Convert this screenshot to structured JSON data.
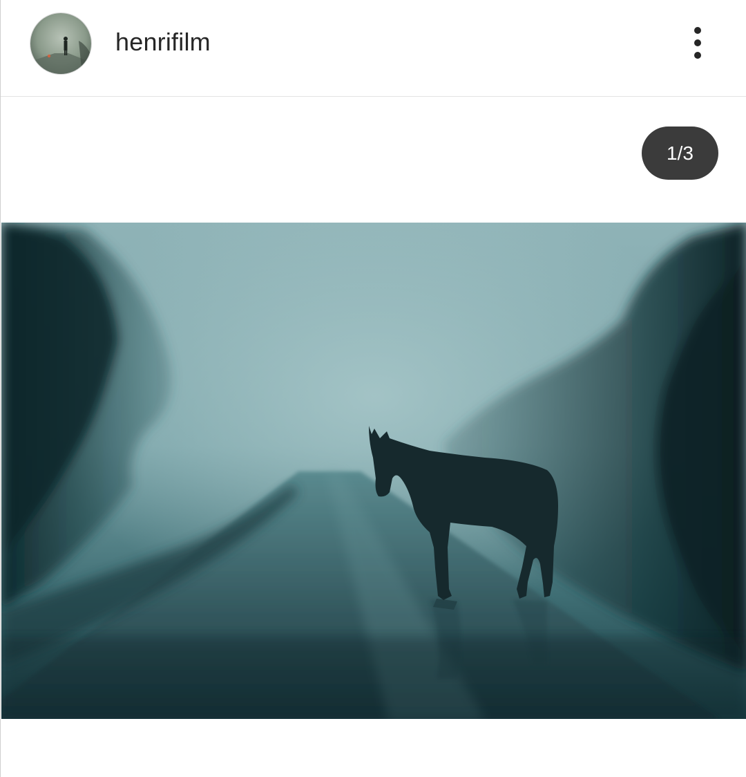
{
  "post": {
    "username": "henrifilm",
    "avatar_icon": "avatar-foggy-figure",
    "more_icon": "more-vertical-icon",
    "counter_text": "1/3",
    "image_description_icon": "foggy-road-horse-photo"
  },
  "colors": {
    "counter_bg": "#3b3b3b",
    "username": "#262626"
  }
}
